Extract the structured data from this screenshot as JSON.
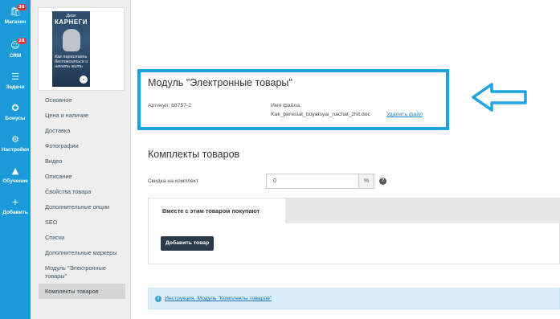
{
  "appnav": {
    "items": [
      {
        "label": "Магазин",
        "icon": "cart-icon",
        "badge": "38"
      },
      {
        "label": "CRM",
        "icon": "people-icon",
        "badge": "28"
      },
      {
        "label": "Задачи",
        "icon": "list-icon",
        "badge": ""
      },
      {
        "label": "Бонусы",
        "icon": "medal-icon",
        "badge": ""
      },
      {
        "label": "Настройки",
        "icon": "gear-icon",
        "badge": ""
      },
      {
        "label": "Обучение",
        "icon": "graduation-cap-icon",
        "badge": ""
      },
      {
        "label": "Добавить",
        "icon": "plus-icon",
        "badge": ""
      }
    ]
  },
  "book": {
    "author": "Дейл",
    "name": "КАРНЕГИ",
    "title": "Как перестать беспокоиться и начать жить"
  },
  "sidebar": {
    "items": [
      {
        "label": "Основное"
      },
      {
        "label": "Цена и наличие"
      },
      {
        "label": "Доставка"
      },
      {
        "label": "Фотографии"
      },
      {
        "label": "Видео"
      },
      {
        "label": "Описание"
      },
      {
        "label": "Свойства товара"
      },
      {
        "label": "Дополнительные опции"
      },
      {
        "label": "SEO"
      },
      {
        "label": "Списки"
      },
      {
        "label": "Дополнительные маркеры"
      },
      {
        "label": "Модуль \"Электронные товары\""
      },
      {
        "label": "Комплекты товаров"
      }
    ],
    "active": "Комплекты товаров"
  },
  "module": {
    "title": "Модуль \"Электронные товары\"",
    "article": "Артикул: 68757-2",
    "file_label": "Имя файла:",
    "file_name": "Kak_perestat_boyatsyai_nachat_zhit.doc",
    "delete_link": "Удалить файл"
  },
  "kits": {
    "title": "Комплекты товаров",
    "discount_label": "Скидка на комплект",
    "discount_value": "0",
    "percent": "%",
    "help": "?",
    "tab_label": "Вместе с этим товаром покупают",
    "add_button": "Добавить товар"
  },
  "info": {
    "icon": "i",
    "link": "Инструкция. Модуль \"Комплекты товаров\""
  },
  "colors": {
    "nav_blue": "#1b9ad8",
    "highlight_blue": "#1ca3e0",
    "badge_red": "#e23b3b",
    "button_dark": "#2b3a4a"
  }
}
